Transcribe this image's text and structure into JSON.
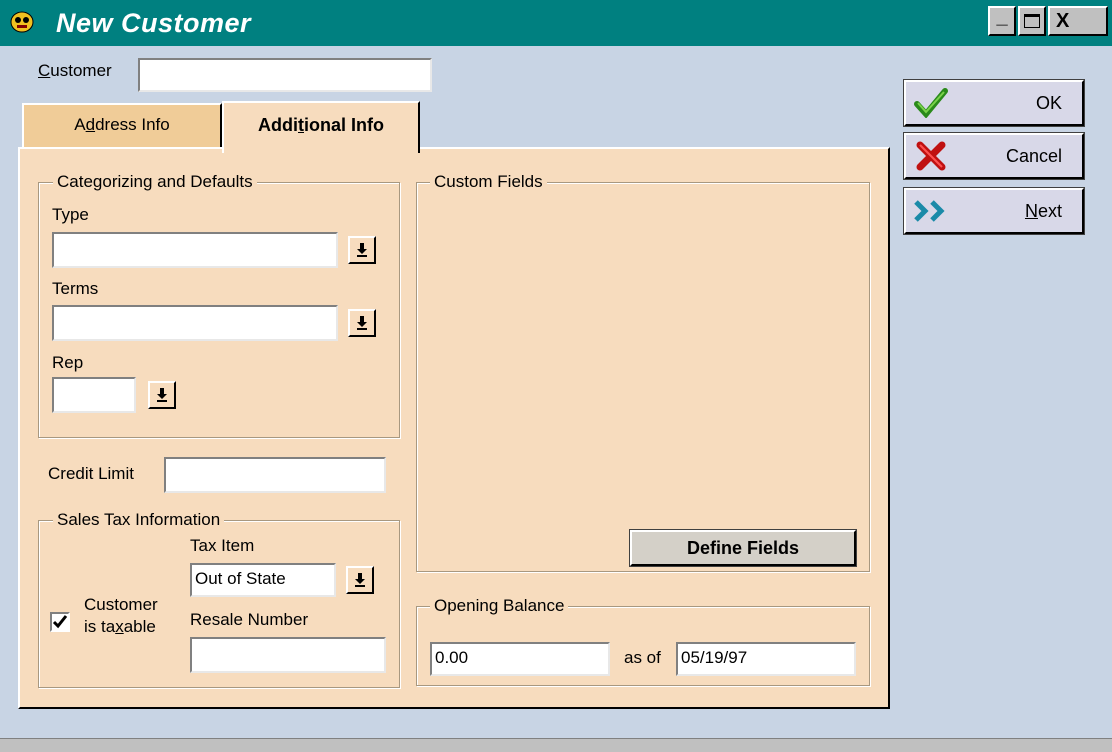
{
  "window": {
    "title": "New Customer",
    "minimize_glyph": "_",
    "close_glyph": "X",
    "title_bar_color": "#008080"
  },
  "customer": {
    "label_mnemonic": "C",
    "label_rest": "ustomer",
    "value": ""
  },
  "tabs": [
    {
      "label_pre": "A",
      "label_mnemonic": "d",
      "label_post": "dress Info",
      "active": false
    },
    {
      "label_pre": "Addi",
      "label_mnemonic": "t",
      "label_post": "ional Info",
      "active": true
    }
  ],
  "categorizing": {
    "title": "Categorizing and Defaults",
    "type_label": "Type",
    "type_value": "",
    "terms_label": "Terms",
    "terms_value": "",
    "rep_label": "Rep",
    "rep_value": ""
  },
  "credit_limit": {
    "label": "Credit Limit",
    "value": ""
  },
  "sales_tax": {
    "title": "Sales Tax Information",
    "tax_item_label": "Tax Item",
    "tax_item_value": "Out of State",
    "taxable_line1": "Customer",
    "taxable_line2_pre": "is ta",
    "taxable_line2_mnemonic": "x",
    "taxable_line2_post": "able",
    "taxable_checked": true,
    "resale_label": "Resale Number",
    "resale_value": ""
  },
  "custom_fields": {
    "title": "Custom Fields",
    "define_button": "Define Fields"
  },
  "opening_balance": {
    "title": "Opening Balance",
    "amount": "0.00",
    "as_of_label": "as of",
    "date": "05/19/97"
  },
  "buttons": {
    "ok": "OK",
    "cancel": "Cancel",
    "next_mnemonic": "N",
    "next_rest": "ext"
  },
  "icons": {
    "app": "qb-app-icon",
    "ok": "checkmark-icon",
    "cancel": "red-x-icon",
    "next": "double-chevron-right-icon",
    "dropdown": "dropdown-arrow-icon"
  }
}
